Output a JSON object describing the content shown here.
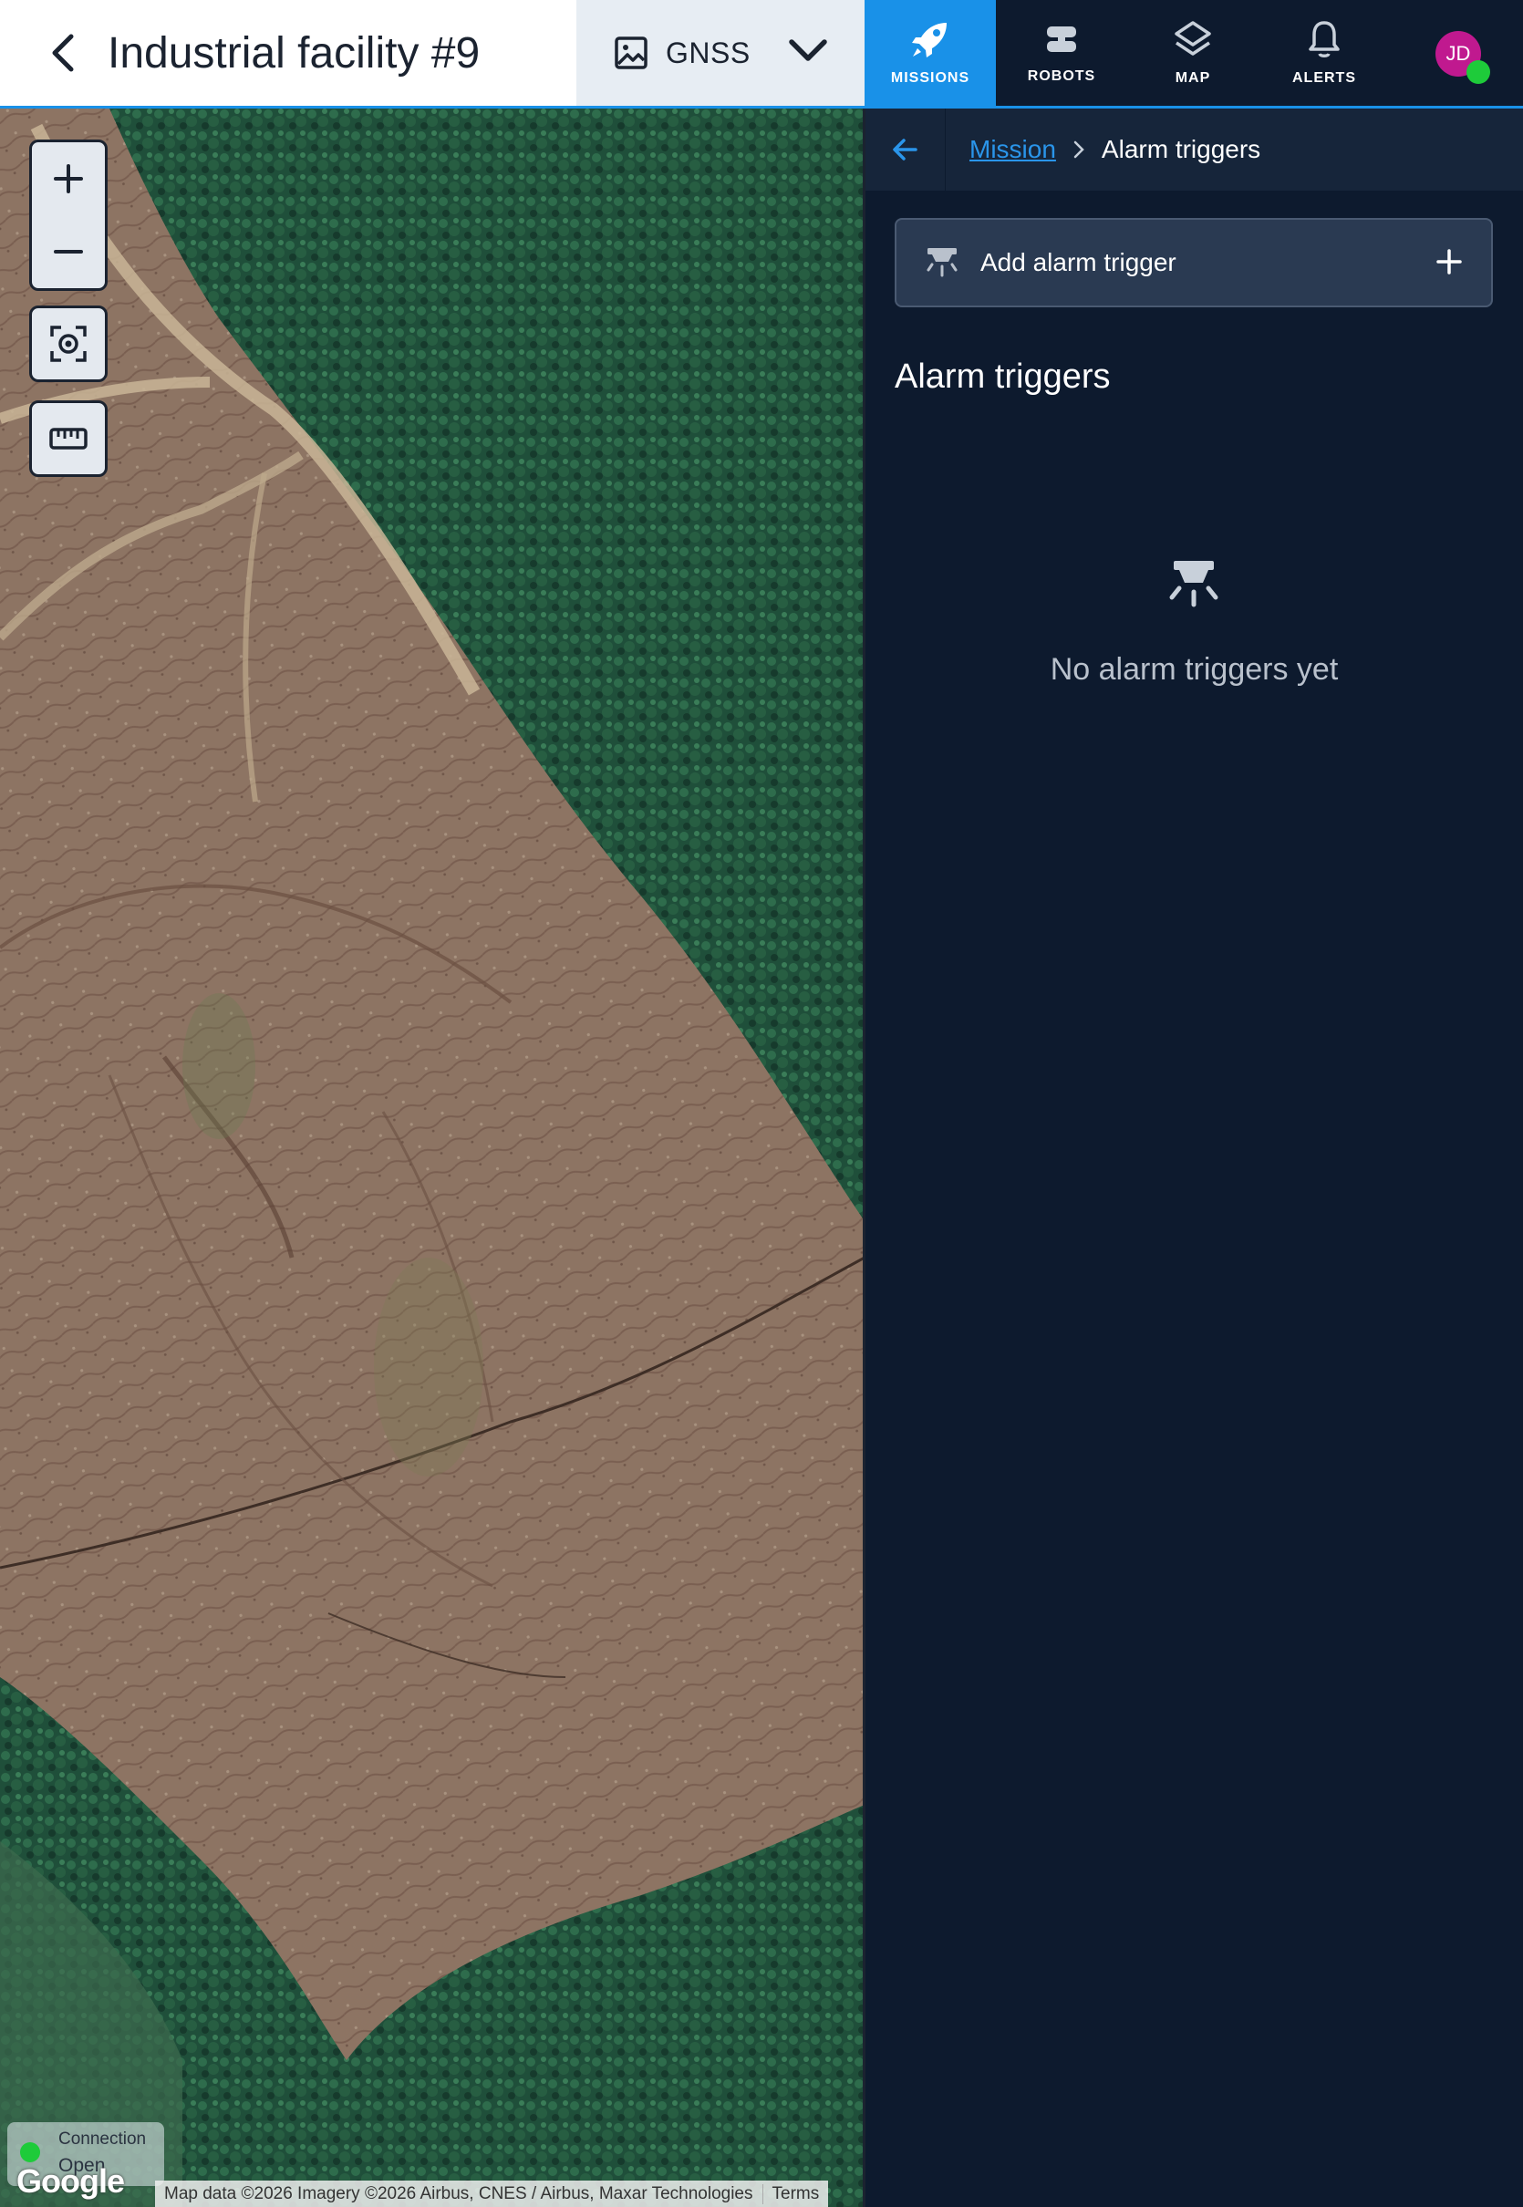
{
  "header": {
    "title": "Industrial facility #9",
    "layer_label": "GNSS"
  },
  "nav": {
    "items": [
      {
        "label": "MISSIONS",
        "icon": "rocket-icon",
        "active": true
      },
      {
        "label": "ROBOTS",
        "icon": "robot-icon",
        "active": false
      },
      {
        "label": "MAP",
        "icon": "layers-icon",
        "active": false
      },
      {
        "label": "ALERTS",
        "icon": "bell-icon",
        "active": false
      }
    ],
    "avatar_initials": "JD"
  },
  "map": {
    "connection_label": "Connection",
    "connection_status": "Open",
    "logo_text": "Google",
    "attribution": "Map data ©2026 Imagery ©2026 Airbus, CNES / Airbus, Maxar Technologies",
    "terms": "Terms"
  },
  "panel": {
    "breadcrumb_parent": "Mission",
    "breadcrumb_current": "Alarm triggers",
    "add_button_label": "Add alarm trigger",
    "section_title": "Alarm triggers",
    "empty_text": "No alarm triggers yet"
  },
  "colors": {
    "accent": "#1991e8",
    "panel_bg": "#0d1a2e",
    "status_green": "#1ecb3a",
    "avatar": "#c0198f"
  }
}
